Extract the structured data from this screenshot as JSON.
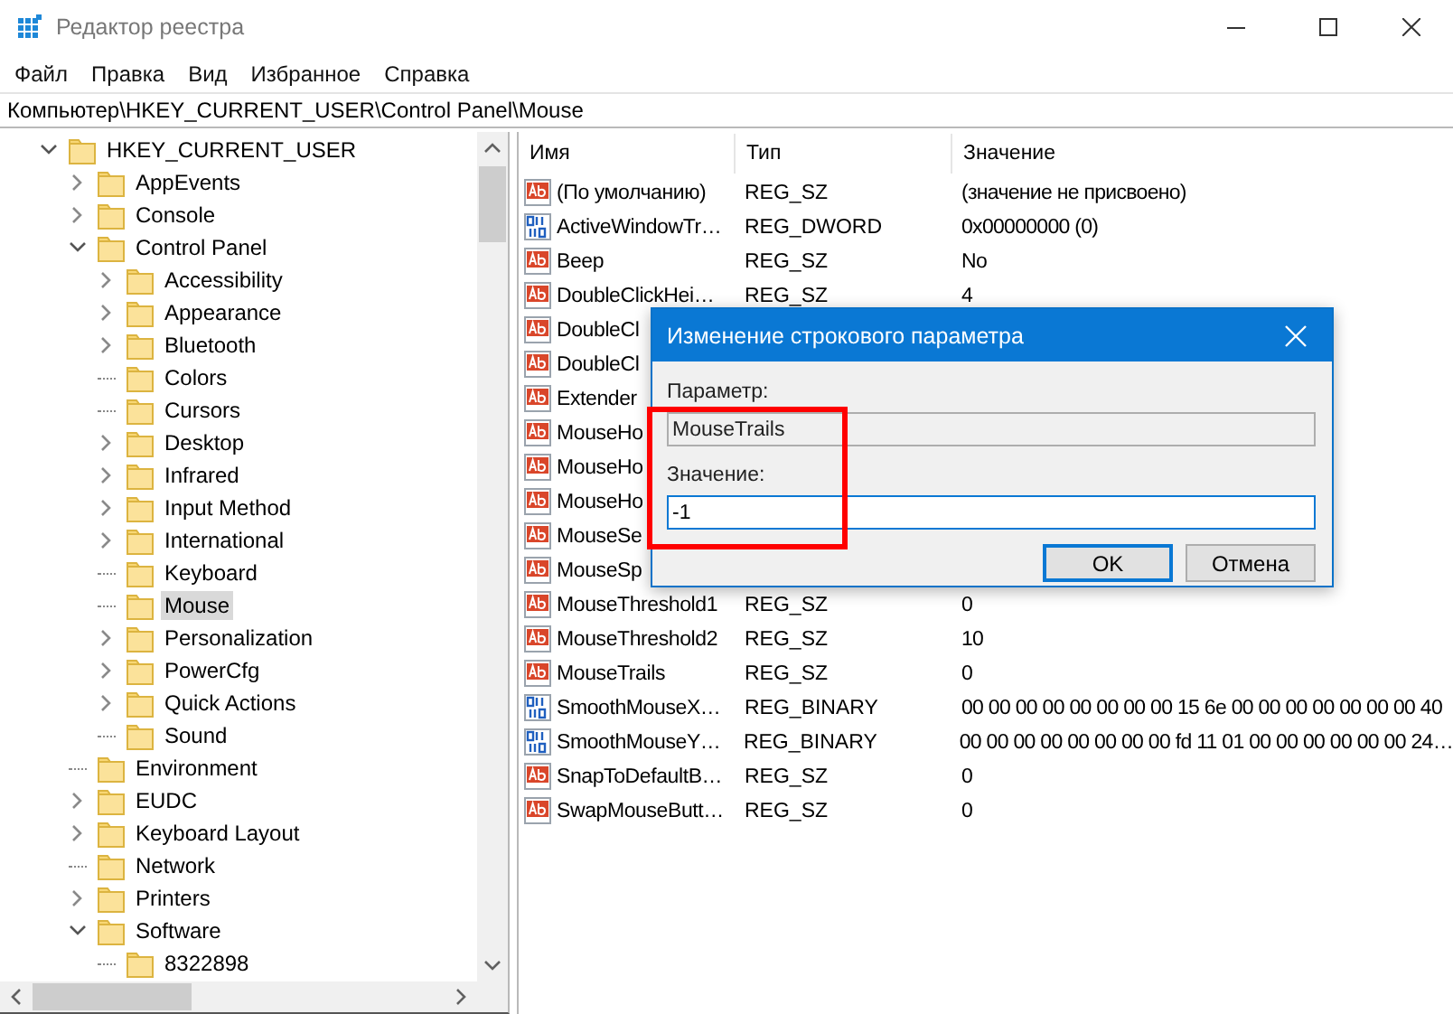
{
  "window": {
    "title": "Редактор реестра"
  },
  "menu": [
    "Файл",
    "Правка",
    "Вид",
    "Избранное",
    "Справка"
  ],
  "address": "Компьютер\\HKEY_CURRENT_USER\\Control Panel\\Mouse",
  "tree": [
    {
      "label": "HKEY_CURRENT_USER",
      "expanded": true,
      "selected": false,
      "children": [
        {
          "label": "AppEvents",
          "expanded": false,
          "selected": false
        },
        {
          "label": "Console",
          "expanded": false,
          "selected": false
        },
        {
          "label": "Control Panel",
          "expanded": true,
          "selected": false,
          "children": [
            {
              "label": "Accessibility",
              "expanded": false,
              "selected": false
            },
            {
              "label": "Appearance",
              "expanded": false,
              "selected": false
            },
            {
              "label": "Bluetooth",
              "expanded": false,
              "selected": false
            },
            {
              "label": "Colors",
              "selected": false
            },
            {
              "label": "Cursors",
              "selected": false
            },
            {
              "label": "Desktop",
              "expanded": false,
              "selected": false
            },
            {
              "label": "Infrared",
              "expanded": false,
              "selected": false
            },
            {
              "label": "Input Method",
              "expanded": false,
              "selected": false
            },
            {
              "label": "International",
              "expanded": false,
              "selected": false
            },
            {
              "label": "Keyboard",
              "selected": false
            },
            {
              "label": "Mouse",
              "selected": true
            },
            {
              "label": "Personalization",
              "expanded": false,
              "selected": false
            },
            {
              "label": "PowerCfg",
              "expanded": false,
              "selected": false
            },
            {
              "label": "Quick Actions",
              "expanded": false,
              "selected": false
            },
            {
              "label": "Sound",
              "selected": false
            }
          ]
        },
        {
          "label": "Environment",
          "selected": false
        },
        {
          "label": "EUDC",
          "expanded": false,
          "selected": false
        },
        {
          "label": "Keyboard Layout",
          "expanded": false,
          "selected": false
        },
        {
          "label": "Network",
          "selected": false
        },
        {
          "label": "Printers",
          "expanded": false,
          "selected": false
        },
        {
          "label": "Software",
          "expanded": true,
          "selected": false,
          "children": [
            {
              "label": "8322898",
              "selected": false
            }
          ]
        }
      ]
    }
  ],
  "list": {
    "columns": [
      "Имя",
      "Тип",
      "Значение"
    ],
    "rows": [
      {
        "kind": "string",
        "name": "(По умолчанию)",
        "type": "REG_SZ",
        "value": "(значение не присвоено)"
      },
      {
        "kind": "binary",
        "name": "ActiveWindowTr…",
        "type": "REG_DWORD",
        "value": "0x00000000 (0)"
      },
      {
        "kind": "string",
        "name": "Beep",
        "type": "REG_SZ",
        "value": "No"
      },
      {
        "kind": "string",
        "name": "DoubleClickHei…",
        "type": "REG_SZ",
        "value": "4"
      },
      {
        "kind": "string",
        "name": "DoubleCl"
      },
      {
        "kind": "string",
        "name": "DoubleCl"
      },
      {
        "kind": "string",
        "name": "Extender"
      },
      {
        "kind": "string",
        "name": "MouseHo"
      },
      {
        "kind": "string",
        "name": "MouseHo"
      },
      {
        "kind": "string",
        "name": "MouseHo"
      },
      {
        "kind": "string",
        "name": "MouseSe"
      },
      {
        "kind": "string",
        "name": "MouseSp"
      },
      {
        "kind": "string",
        "name": "MouseThreshold1",
        "type": "REG_SZ",
        "value": "0"
      },
      {
        "kind": "string",
        "name": "MouseThreshold2",
        "type": "REG_SZ",
        "value": "10"
      },
      {
        "kind": "string",
        "name": "MouseTrails",
        "type": "REG_SZ",
        "value": "0"
      },
      {
        "kind": "binary",
        "name": "SmoothMouseX…",
        "type": "REG_BINARY",
        "value": "00 00 00 00 00 00 00 00 15 6e 00 00 00 00 00 00 00 40"
      },
      {
        "kind": "binary",
        "name": "SmoothMouseY…",
        "type": "REG_BINARY",
        "value": "00 00 00 00 00 00 00 00 fd 11 01 00 00 00 00 00 00 24…"
      },
      {
        "kind": "string",
        "name": "SnapToDefaultB…",
        "type": "REG_SZ",
        "value": "0"
      },
      {
        "kind": "string",
        "name": "SwapMouseButt…",
        "type": "REG_SZ",
        "value": "0"
      }
    ]
  },
  "dialog": {
    "title": "Изменение строкового параметра",
    "name_label": "Параметр:",
    "name_value": "MouseTrails",
    "value_label": "Значение:",
    "value": "-1",
    "buttons": [
      {
        "label": "OK",
        "default": true
      },
      {
        "label": "Отмена",
        "default": false
      }
    ]
  }
}
